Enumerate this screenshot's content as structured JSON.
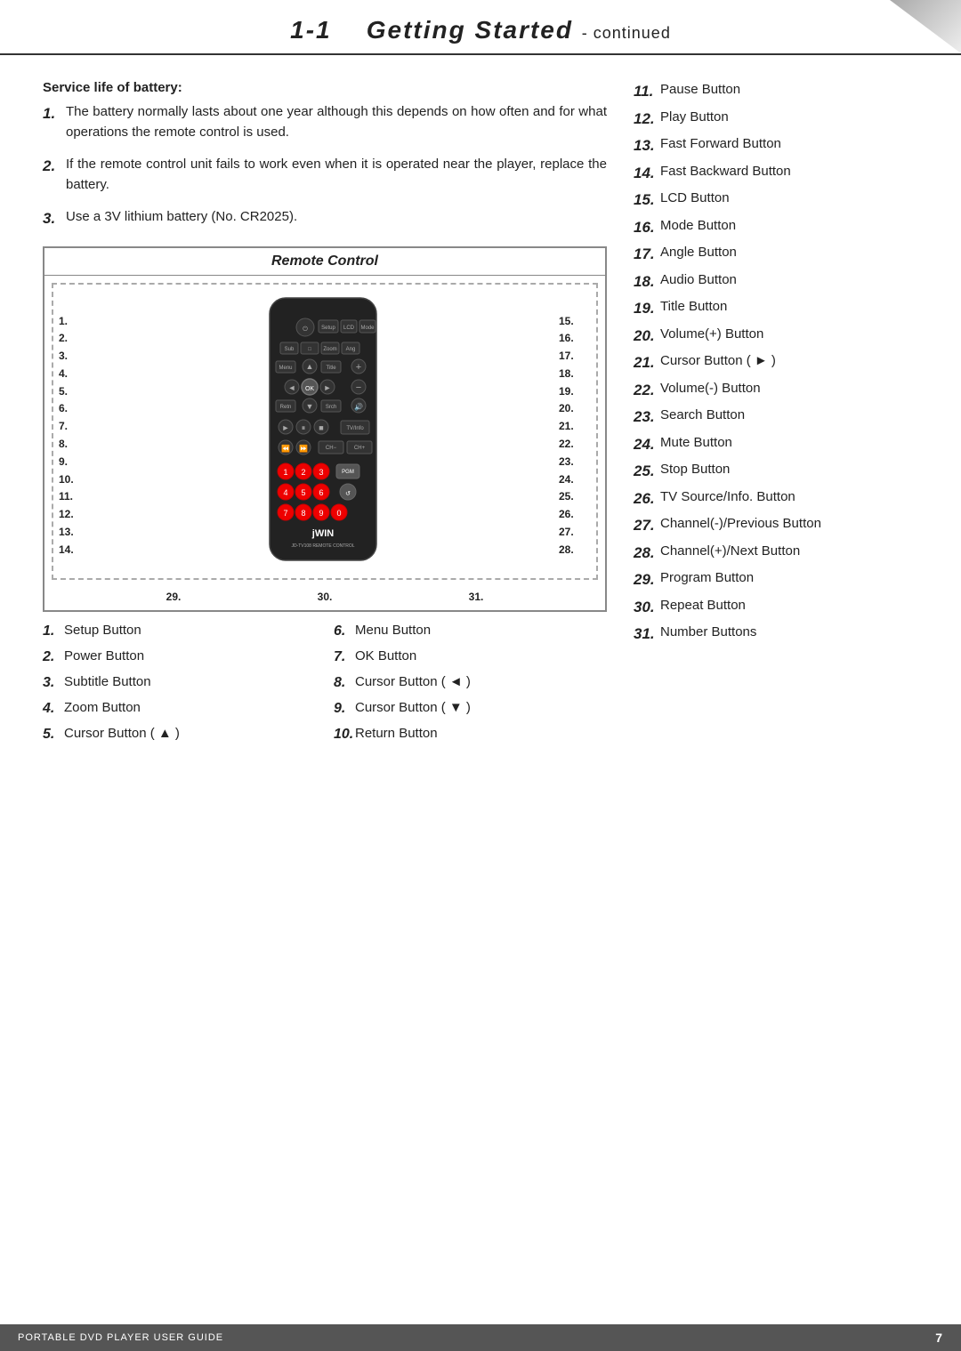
{
  "header": {
    "title": "1-1",
    "subtitle": "Getting Started",
    "continued": "- continued"
  },
  "battery_section": {
    "title": "Service life of battery:",
    "items": [
      {
        "num": "1.",
        "text": "The battery normally lasts about one year although this depends on how often and for what operations the remote control is used."
      },
      {
        "num": "2.",
        "text": "If the remote control unit fails to work even when it is operated near the player, replace the battery."
      },
      {
        "num": "3.",
        "text": "Use a 3V lithium battery (No. CR2025)."
      }
    ]
  },
  "remote_box": {
    "title": "Remote Control",
    "left_nums": [
      "1.",
      "2.",
      "3.",
      "4.",
      "5.",
      "6.",
      "7.",
      "8.",
      "9.",
      "10.",
      "11.",
      "12.",
      "13.",
      "14."
    ],
    "right_nums": [
      "15.",
      "16.",
      "17.",
      "18.",
      "19.",
      "20.",
      "21.",
      "22.",
      "23.",
      "24.",
      "25.",
      "26.",
      "27.",
      "28."
    ],
    "bottom_nums": [
      "29.",
      "30.",
      "31."
    ]
  },
  "bottom_list": [
    {
      "num": "1.",
      "text": "Setup Button"
    },
    {
      "num": "2.",
      "text": "Power Button"
    },
    {
      "num": "3.",
      "text": "Subtitle Button"
    },
    {
      "num": "4.",
      "text": "Zoom Button"
    },
    {
      "num": "5.",
      "text": "Cursor Button ( ▲ )"
    },
    {
      "num": "6.",
      "text": "Menu Button"
    },
    {
      "num": "7.",
      "text": "OK Button"
    },
    {
      "num": "8.",
      "text": "Cursor Button ( ◄ )"
    },
    {
      "num": "9.",
      "text": "Cursor Button ( ▼ )"
    },
    {
      "num": "10.",
      "text": "Return Button"
    }
  ],
  "right_list": [
    {
      "num": "11.",
      "text": "Pause Button"
    },
    {
      "num": "12.",
      "text": "Play Button"
    },
    {
      "num": "13.",
      "text": "Fast Forward Button"
    },
    {
      "num": "14.",
      "text": "Fast Backward Button"
    },
    {
      "num": "15.",
      "text": "LCD Button"
    },
    {
      "num": "16.",
      "text": "Mode Button"
    },
    {
      "num": "17.",
      "text": "Angle Button"
    },
    {
      "num": "18.",
      "text": "Audio Button"
    },
    {
      "num": "19.",
      "text": "Title Button"
    },
    {
      "num": "20.",
      "text": "Volume(+) Button"
    },
    {
      "num": "21.",
      "text": "Cursor Button ( ► )"
    },
    {
      "num": "22.",
      "text": "Volume(-) Button"
    },
    {
      "num": "23.",
      "text": "Search Button"
    },
    {
      "num": "24.",
      "text": "Mute Button"
    },
    {
      "num": "25.",
      "text": "Stop Button"
    },
    {
      "num": "26.",
      "text": "TV Source/Info. Button"
    },
    {
      "num": "27.",
      "text": "Channel(-)/Previous Button"
    },
    {
      "num": "28.",
      "text": "Channel(+)/Next Button"
    },
    {
      "num": "29.",
      "text": "Program Button"
    },
    {
      "num": "30.",
      "text": "Repeat Button"
    },
    {
      "num": "31.",
      "text": "Number Buttons"
    }
  ],
  "footer": {
    "label": "PORTABLE DVD PLAYER USER GUIDE",
    "page": "7"
  }
}
